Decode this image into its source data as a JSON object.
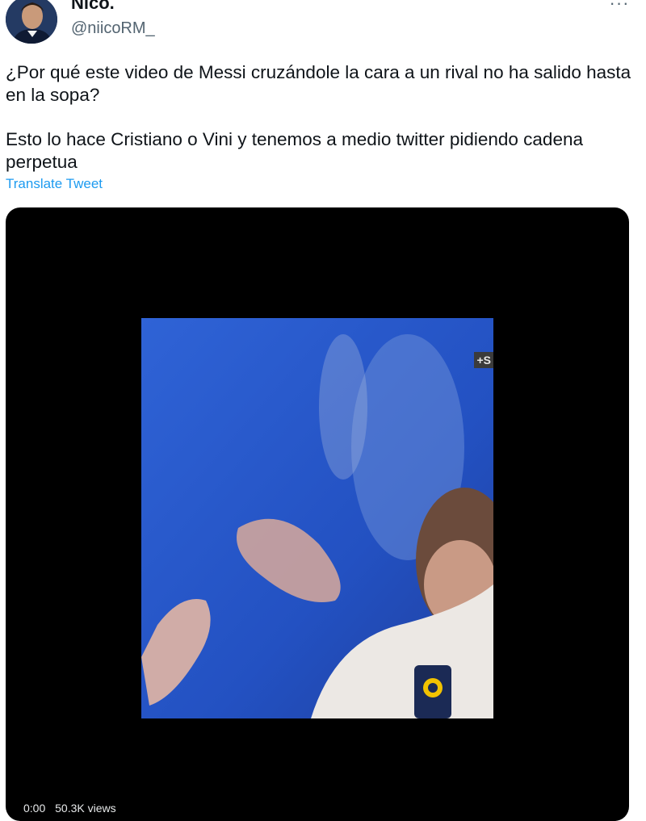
{
  "author": {
    "display_name": "Nico.",
    "handle": "@niicoRM_",
    "avatar_icon": "profile-photo-icon"
  },
  "more_icon": "more-options-icon",
  "tweet": {
    "paragraphs": [
      "¿Por qué este video de Messi cruzándole la cara a un rival no ha salido hasta en la sopa?",
      "Esto lo hace Cristiano o Vini y tenemos a medio twitter pidiendo cadena perpetua"
    ],
    "translate_label": "Translate Tweet"
  },
  "video": {
    "watermark": "+S",
    "timestamp": "0:00",
    "views": "50.3K views"
  },
  "colors": {
    "link": "#1d9bf0",
    "video_blue": "#2457c6",
    "media_background": "#000000"
  }
}
